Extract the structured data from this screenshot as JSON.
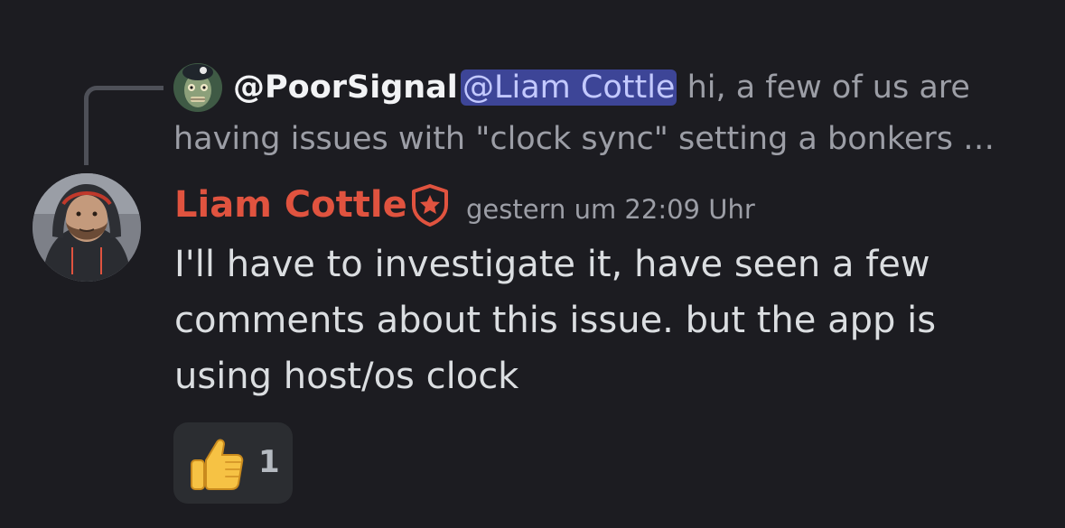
{
  "reply": {
    "author": "@PoorSignal",
    "mention": "@Liam Cottle",
    "line1_rest": " hi, a few of us are",
    "line2": "having issues with \"clock sync\" setting a bonkers …"
  },
  "message": {
    "author": "Liam Cottle",
    "timestamp": "gestern um 22:09 Uhr",
    "lines": [
      "I'll have to investigate it, have seen a few",
      "comments about this issue. but the app is",
      "using host/os clock"
    ],
    "author_color": "#e0533f"
  },
  "reactions": [
    {
      "emoji": "thumbs-up-icon",
      "count": "1"
    }
  ],
  "colors": {
    "background": "#1c1c21",
    "mention_bg": "#3d4597",
    "reaction_bg": "#2b2d31"
  }
}
